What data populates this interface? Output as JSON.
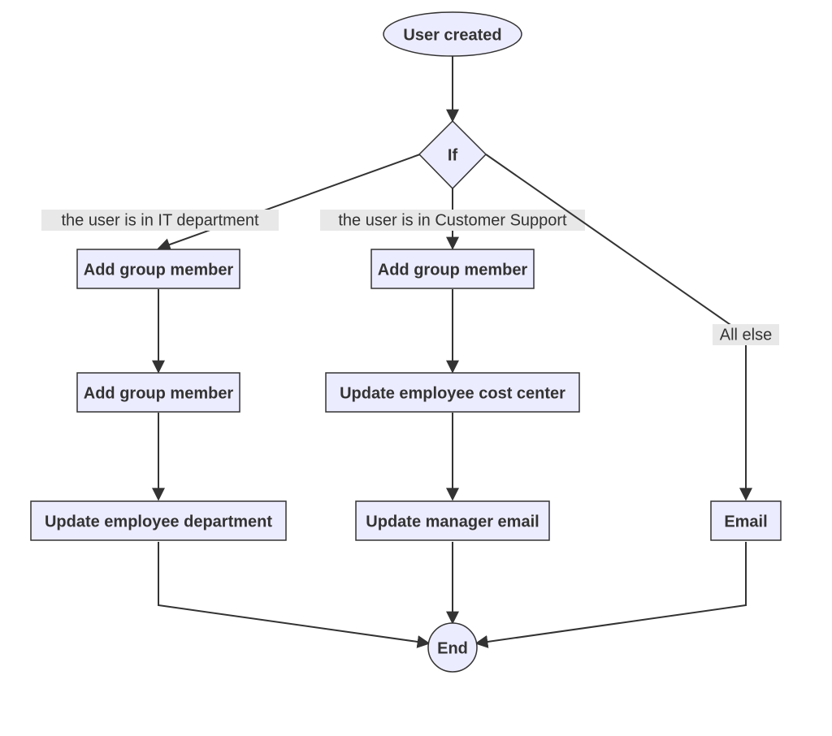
{
  "nodes": {
    "start": {
      "label": "User created"
    },
    "decision": {
      "label": "If"
    },
    "branch1_step1": {
      "label": "Add group member"
    },
    "branch1_step2": {
      "label": "Add group member"
    },
    "branch1_step3": {
      "label": "Update employee department"
    },
    "branch2_step1": {
      "label": "Add group member"
    },
    "branch2_step2": {
      "label": "Update employee cost center"
    },
    "branch2_step3": {
      "label": "Update manager email"
    },
    "branch3_step1": {
      "label": "Email"
    },
    "end": {
      "label": "End"
    }
  },
  "edge_labels": {
    "branch1": "the user is in IT department",
    "branch2": "the user is in Customer Support",
    "branch3": "All else"
  },
  "chart_data": {
    "type": "flowchart",
    "start_node": "User created",
    "decision_node": "If",
    "end_node": "End",
    "branches": [
      {
        "condition": "the user is in IT department",
        "steps": [
          "Add group member",
          "Add group member",
          "Update employee department"
        ]
      },
      {
        "condition": "the user is in Customer Support",
        "steps": [
          "Add group member",
          "Update employee cost center",
          "Update manager email"
        ]
      },
      {
        "condition": "All else",
        "steps": [
          "Email"
        ]
      }
    ],
    "edges": [
      [
        "User created",
        "If"
      ],
      [
        "If",
        "Add group member (IT 1)",
        "the user is in IT department"
      ],
      [
        "Add group member (IT 1)",
        "Add group member (IT 2)"
      ],
      [
        "Add group member (IT 2)",
        "Update employee department"
      ],
      [
        "Update employee department",
        "End"
      ],
      [
        "If",
        "Add group member (CS)",
        "the user is in Customer Support"
      ],
      [
        "Add group member (CS)",
        "Update employee cost center"
      ],
      [
        "Update employee cost center",
        "Update manager email"
      ],
      [
        "Update manager email",
        "End"
      ],
      [
        "If",
        "Email",
        "All else"
      ],
      [
        "Email",
        "End"
      ]
    ]
  }
}
